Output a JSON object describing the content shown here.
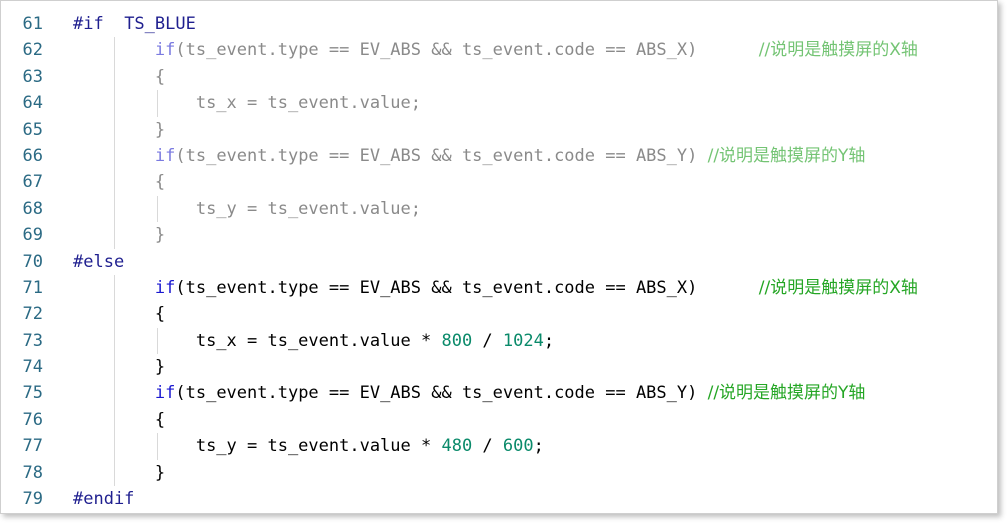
{
  "lines": [
    {
      "n": "61",
      "tokens": [
        {
          "t": "#if  ",
          "c": "pp"
        },
        {
          "t": "TS_BLUE",
          "c": "pp"
        }
      ]
    },
    {
      "n": "62",
      "tokens": [
        {
          "t": "        ",
          "c": "id"
        },
        {
          "t": "if",
          "c": "dimkw"
        },
        {
          "t": "(ts_event.type == EV_ABS && ts_event.code == ABS_X)      ",
          "c": "dim"
        },
        {
          "t": "//说明是触摸屏的X轴",
          "c": "dimcm"
        }
      ]
    },
    {
      "n": "63",
      "tokens": [
        {
          "t": "        ",
          "c": "id"
        },
        {
          "t": "{",
          "c": "dim"
        }
      ]
    },
    {
      "n": "64",
      "tokens": [
        {
          "t": "            ",
          "c": "id"
        },
        {
          "t": "ts_x = ts_event.value;",
          "c": "dim"
        }
      ]
    },
    {
      "n": "65",
      "tokens": [
        {
          "t": "        ",
          "c": "id"
        },
        {
          "t": "}",
          "c": "dim"
        }
      ]
    },
    {
      "n": "66",
      "tokens": [
        {
          "t": "        ",
          "c": "id"
        },
        {
          "t": "if",
          "c": "dimkw"
        },
        {
          "t": "(ts_event.type == EV_ABS && ts_event.code == ABS_Y) ",
          "c": "dim"
        },
        {
          "t": "//说明是触摸屏的Y轴",
          "c": "dimcm"
        }
      ]
    },
    {
      "n": "67",
      "tokens": [
        {
          "t": "        ",
          "c": "id"
        },
        {
          "t": "{",
          "c": "dim"
        }
      ]
    },
    {
      "n": "68",
      "tokens": [
        {
          "t": "            ",
          "c": "id"
        },
        {
          "t": "ts_y = ts_event.value;",
          "c": "dim"
        }
      ]
    },
    {
      "n": "69",
      "tokens": [
        {
          "t": "        ",
          "c": "id"
        },
        {
          "t": "}",
          "c": "dim"
        }
      ]
    },
    {
      "n": "70",
      "tokens": [
        {
          "t": "#else",
          "c": "pp"
        }
      ]
    },
    {
      "n": "71",
      "tokens": [
        {
          "t": "        ",
          "c": "id"
        },
        {
          "t": "if",
          "c": "kw"
        },
        {
          "t": "(ts_event.type == EV_ABS && ts_event.code == ABS_X)      ",
          "c": "id"
        },
        {
          "t": "//说明是触摸屏的X轴",
          "c": "cm"
        }
      ]
    },
    {
      "n": "72",
      "tokens": [
        {
          "t": "        ",
          "c": "id"
        },
        {
          "t": "{",
          "c": "id"
        }
      ]
    },
    {
      "n": "73",
      "tokens": [
        {
          "t": "            ",
          "c": "id"
        },
        {
          "t": "ts_x = ts_event.value * ",
          "c": "id"
        },
        {
          "t": "800",
          "c": "num"
        },
        {
          "t": " / ",
          "c": "id"
        },
        {
          "t": "1024",
          "c": "num"
        },
        {
          "t": ";",
          "c": "id"
        }
      ]
    },
    {
      "n": "74",
      "tokens": [
        {
          "t": "        ",
          "c": "id"
        },
        {
          "t": "}",
          "c": "id"
        }
      ]
    },
    {
      "n": "75",
      "tokens": [
        {
          "t": "        ",
          "c": "id"
        },
        {
          "t": "if",
          "c": "kw"
        },
        {
          "t": "(ts_event.type == EV_ABS && ts_event.code == ABS_Y) ",
          "c": "id"
        },
        {
          "t": "//说明是触摸屏的Y轴",
          "c": "cm"
        }
      ]
    },
    {
      "n": "76",
      "tokens": [
        {
          "t": "        ",
          "c": "id"
        },
        {
          "t": "{",
          "c": "id"
        }
      ]
    },
    {
      "n": "77",
      "tokens": [
        {
          "t": "            ",
          "c": "id"
        },
        {
          "t": "ts_y = ts_event.value * ",
          "c": "id"
        },
        {
          "t": "480",
          "c": "num"
        },
        {
          "t": " / ",
          "c": "id"
        },
        {
          "t": "600",
          "c": "num"
        },
        {
          "t": ";",
          "c": "id"
        }
      ]
    },
    {
      "n": "78",
      "tokens": [
        {
          "t": "        ",
          "c": "id"
        },
        {
          "t": "}",
          "c": "id"
        }
      ]
    },
    {
      "n": "79",
      "tokens": [
        {
          "t": "#endif",
          "c": "pp"
        }
      ]
    }
  ]
}
